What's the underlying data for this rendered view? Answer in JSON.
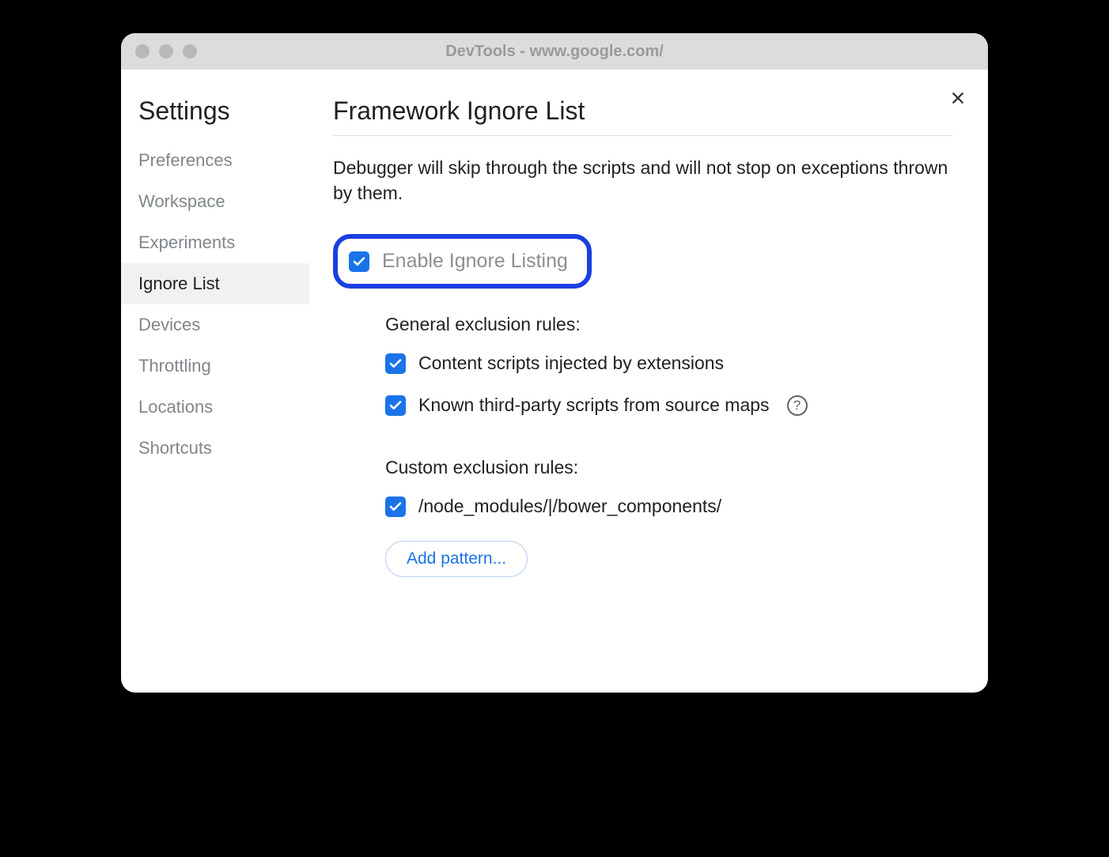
{
  "window": {
    "title": "DevTools - www.google.com/"
  },
  "sidebar": {
    "heading": "Settings",
    "items": [
      {
        "label": "Preferences",
        "active": false
      },
      {
        "label": "Workspace",
        "active": false
      },
      {
        "label": "Experiments",
        "active": false
      },
      {
        "label": "Ignore List",
        "active": true
      },
      {
        "label": "Devices",
        "active": false
      },
      {
        "label": "Throttling",
        "active": false
      },
      {
        "label": "Locations",
        "active": false
      },
      {
        "label": "Shortcuts",
        "active": false
      }
    ]
  },
  "main": {
    "title": "Framework Ignore List",
    "description": "Debugger will skip through the scripts and will not stop on exceptions thrown by them.",
    "enable": {
      "label": "Enable Ignore Listing",
      "checked": true
    },
    "general": {
      "header": "General exclusion rules:",
      "rules": [
        {
          "label": "Content scripts injected by extensions",
          "checked": true,
          "help": false
        },
        {
          "label": "Known third-party scripts from source maps",
          "checked": true,
          "help": true
        }
      ]
    },
    "custom": {
      "header": "Custom exclusion rules:",
      "rules": [
        {
          "label": "/node_modules/|/bower_components/",
          "checked": true
        }
      ],
      "add_button": "Add pattern..."
    }
  }
}
